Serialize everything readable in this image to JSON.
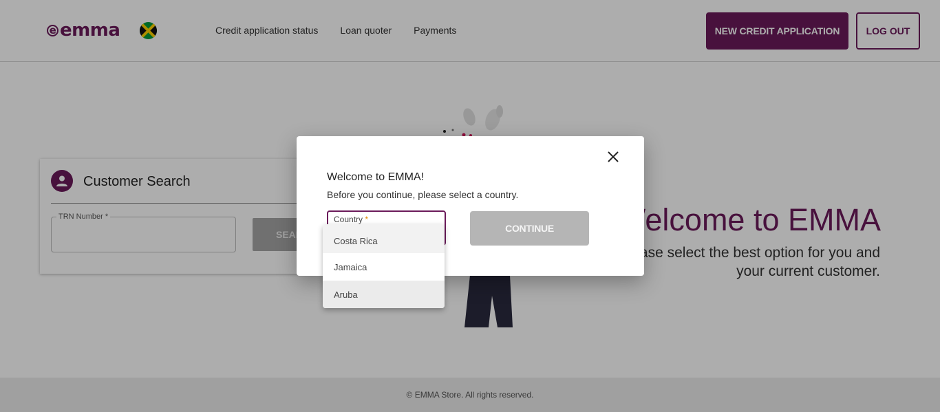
{
  "header": {
    "logo_text": "emma",
    "flag_icon": "jamaica-flag-icon",
    "nav": [
      "Credit application status",
      "Loan quoter",
      "Payments"
    ],
    "new_application_label": "NEW CREDIT APPLICATION",
    "logout_label": "LOG OUT"
  },
  "customer_search": {
    "title": "Customer Search",
    "trn_label": "TRN Number *",
    "search_label": "SEARCH"
  },
  "welcome": {
    "title": "Welcome to EMMA",
    "subtitle": "Please select the best option for you and your current customer."
  },
  "footer": {
    "text": "© EMMA Store. All rights reserved."
  },
  "modal": {
    "title": "Welcome to EMMA!",
    "text": "Before you continue, please select a country.",
    "country_label": "Country",
    "country_required": "*",
    "country_value": "Costa Rica",
    "continue_label": "CONTINUE",
    "options": [
      "Costa Rica",
      "Jamaica",
      "Aruba"
    ]
  },
  "colors": {
    "brand": "#6b1a5a",
    "required": "#e68a00"
  }
}
